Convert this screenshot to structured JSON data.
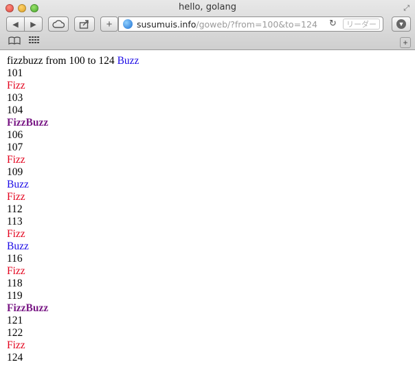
{
  "window": {
    "title": "hello, golang",
    "url_host": "susumuis.info",
    "url_path": "/goweb/?from=100&to=124",
    "reader_label": "リーダー"
  },
  "colors": {
    "fizz": "#e3001b",
    "buzz": "#1a08e6",
    "fizzbuzz": "#7a1a86"
  },
  "icons": {
    "back": "back-arrow",
    "forward": "forward-arrow",
    "cloud": "cloud",
    "share": "share",
    "add": "plus",
    "globe": "globe",
    "reload": "reload",
    "download": "download",
    "bookmarks": "book",
    "top_sites": "grid"
  },
  "page": {
    "heading": {
      "text": "fizzbuzz from 100 to 124",
      "suffix": "Buzz"
    },
    "lines": [
      {
        "text": "101",
        "kind": "number"
      },
      {
        "text": "Fizz",
        "kind": "fizz"
      },
      {
        "text": "103",
        "kind": "number"
      },
      {
        "text": "104",
        "kind": "number"
      },
      {
        "text": "FizzBuzz",
        "kind": "fizzbuzz"
      },
      {
        "text": "106",
        "kind": "number"
      },
      {
        "text": "107",
        "kind": "number"
      },
      {
        "text": "Fizz",
        "kind": "fizz"
      },
      {
        "text": "109",
        "kind": "number"
      },
      {
        "text": "Buzz",
        "kind": "buzz"
      },
      {
        "text": "Fizz",
        "kind": "fizz"
      },
      {
        "text": "112",
        "kind": "number"
      },
      {
        "text": "113",
        "kind": "number"
      },
      {
        "text": "Fizz",
        "kind": "fizz"
      },
      {
        "text": "Buzz",
        "kind": "buzz"
      },
      {
        "text": "116",
        "kind": "number"
      },
      {
        "text": "Fizz",
        "kind": "fizz"
      },
      {
        "text": "118",
        "kind": "number"
      },
      {
        "text": "119",
        "kind": "number"
      },
      {
        "text": "FizzBuzz",
        "kind": "fizzbuzz"
      },
      {
        "text": "121",
        "kind": "number"
      },
      {
        "text": "122",
        "kind": "number"
      },
      {
        "text": "Fizz",
        "kind": "fizz"
      },
      {
        "text": "124",
        "kind": "number"
      }
    ]
  }
}
